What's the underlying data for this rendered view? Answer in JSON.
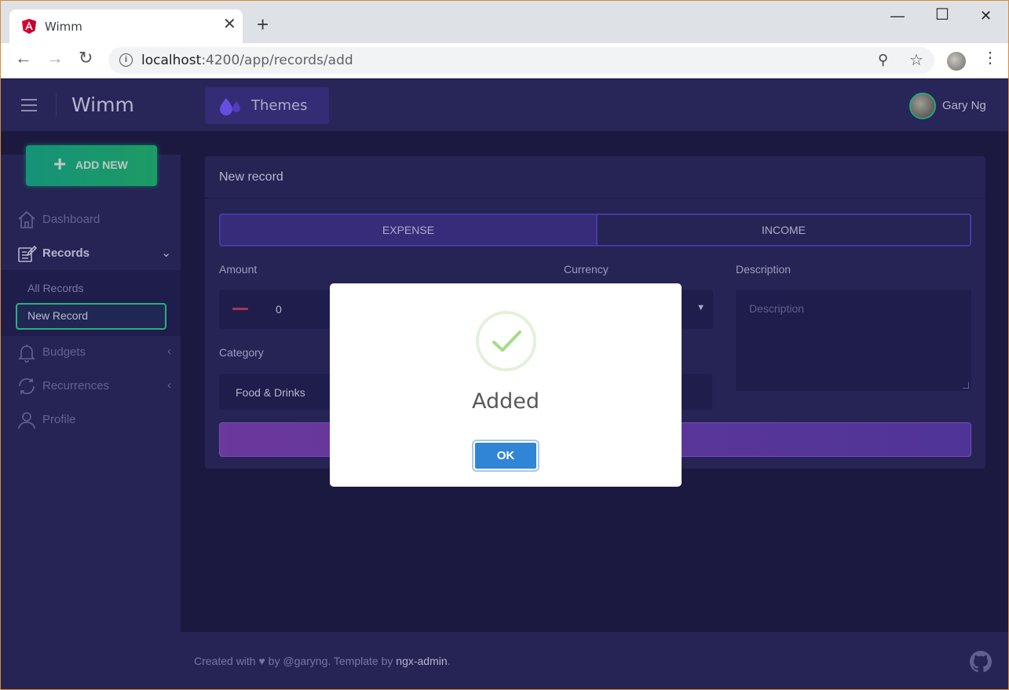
{
  "browser": {
    "tab_title": "Wimm",
    "tab_close": "✕",
    "new_tab": "+",
    "url_host": "localhost",
    "url_path": ":4200/app/records/add",
    "controls": {
      "minimize": "—",
      "maximize": "☐",
      "close": "✕"
    }
  },
  "header": {
    "brand": "Wimm",
    "themes_label": "Themes",
    "user_name": "Gary Ng"
  },
  "sidebar": {
    "add_new_label": "ADD NEW",
    "items": [
      {
        "label": "Dashboard",
        "icon": "home-icon"
      },
      {
        "label": "Records",
        "icon": "edit-icon",
        "expanded": true
      },
      {
        "label": "Budgets",
        "icon": "bell-icon"
      },
      {
        "label": "Recurrences",
        "icon": "refresh-icon"
      },
      {
        "label": "Profile",
        "icon": "person-icon"
      }
    ],
    "records_sub": [
      {
        "label": "All Records"
      },
      {
        "label": "New Record",
        "active": true
      }
    ]
  },
  "form": {
    "card_title": "New record",
    "type_options": [
      "EXPENSE",
      "INCOME"
    ],
    "selected_type": "EXPENSE",
    "amount_label": "Amount",
    "amount_value": "0",
    "currency_label": "Currency",
    "description_label": "Description",
    "description_placeholder": "Description",
    "category_label": "Category",
    "category_value": "Food & Drinks"
  },
  "footer": {
    "prefix": "Created with ♥ by @garyng. Template by ",
    "link": "ngx-admin",
    "suffix": "."
  },
  "modal": {
    "title": "Added",
    "ok_label": "OK"
  },
  "colors": {
    "background": "#1e1b44",
    "panel": "#2a275b",
    "accent_green": "#1fb36f",
    "modal_button": "#3085d6"
  }
}
